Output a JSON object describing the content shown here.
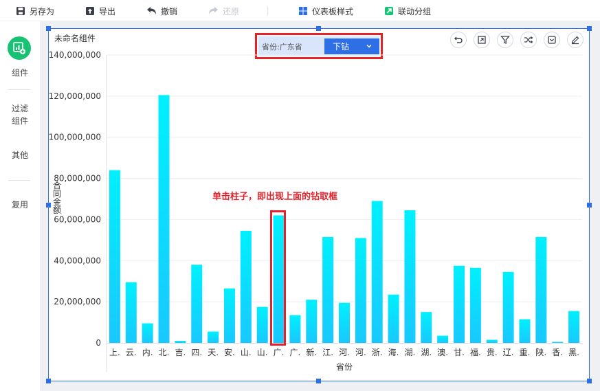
{
  "toolbar": {
    "save_as": "另存为",
    "export": "导出",
    "undo": "撤销",
    "redo": "还原",
    "dashboard_style": "仪表板样式",
    "link_group": "联动分组"
  },
  "sidebar": {
    "items": [
      {
        "label": "组件"
      },
      {
        "label": "过滤\n组件"
      },
      {
        "label": "其他"
      },
      {
        "label": "复用"
      }
    ]
  },
  "widget": {
    "title": "未命名组件",
    "drill": {
      "label": "省份:广东省",
      "button": "下钻"
    },
    "annotation": "单击柱子，即出现上面的钻取框",
    "y_axis_label": "合同金额",
    "x_axis_label": "省份"
  },
  "colors": {
    "accent": "#2f6fe5",
    "highlight": "#e5222a",
    "bar": "#00e5ff",
    "rail_active": "#17c275"
  },
  "chart_data": {
    "type": "bar",
    "xlabel": "省份",
    "ylabel": "合同金额",
    "ylim": [
      0,
      140000000
    ],
    "yticks": [
      "0",
      "20,000,000",
      "40,000,000",
      "60,000,000",
      "80,000,000",
      "100,000,000",
      "120,000,000",
      "140,000,000"
    ],
    "categories": [
      "上.",
      "云.",
      "内.",
      "北.",
      "吉.",
      "四.",
      "天.",
      "安.",
      "山.",
      "山.",
      "广.",
      "广.",
      "新.",
      "江.",
      "河.",
      "河.",
      "浙.",
      "海.",
      "湖.",
      "湖.",
      "澳.",
      "甘.",
      "福.",
      "贵.",
      "辽.",
      "重.",
      "陕.",
      "香.",
      "黑."
    ],
    "values": [
      84000000,
      29500000,
      9500000,
      120500000,
      1000000,
      38000000,
      5500000,
      26500000,
      54500000,
      17500000,
      62000000,
      13500000,
      21000000,
      51500000,
      19500000,
      51000000,
      69000000,
      23500000,
      64500000,
      15000000,
      3500000,
      37500000,
      36500000,
      1500000,
      34500000,
      11500000,
      51500000,
      500000,
      15500000
    ],
    "highlight_index": 10
  }
}
